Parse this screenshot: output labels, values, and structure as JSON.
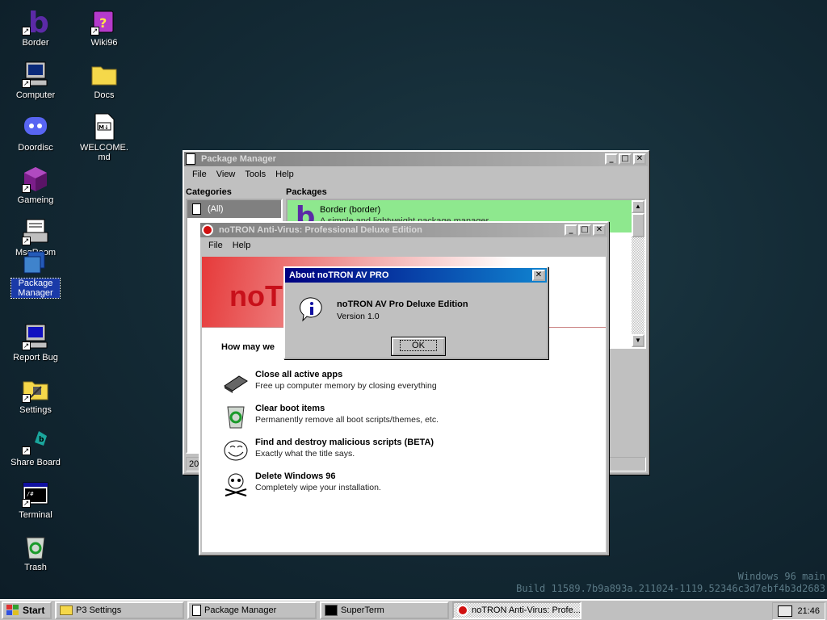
{
  "desktop": {
    "icons": [
      {
        "label": "Border",
        "icon": "border-b-icon"
      },
      {
        "label": "Wiki96",
        "icon": "wiki-book-icon"
      },
      {
        "label": "Computer",
        "icon": "computer-icon"
      },
      {
        "label": "Docs",
        "icon": "folder-icon"
      },
      {
        "label": "Doordisc",
        "icon": "discord-icon"
      },
      {
        "label": "WELCOME.md",
        "icon": "markdown-file-icon"
      },
      {
        "label": "Gameing",
        "icon": "cube-icon"
      },
      {
        "label": "MsgRoom",
        "icon": "msgroom-icon"
      },
      {
        "label": "Package Manager",
        "icon": "package-manager-icon"
      },
      {
        "label": "Report Bug",
        "icon": "report-bug-icon"
      },
      {
        "label": "Settings",
        "icon": "settings-icon"
      },
      {
        "label": "Share Board",
        "icon": "share-board-icon"
      },
      {
        "label": "Terminal",
        "icon": "terminal-icon"
      },
      {
        "label": "Trash",
        "icon": "trash-icon"
      }
    ],
    "watermark": {
      "line1": "Windows 96 main",
      "line2": "Build 11589.7b9a893a.211024-1119.52346c3d7ebf4b3d2683"
    }
  },
  "package_manager": {
    "title": "Package Manager",
    "menu": [
      "File",
      "View",
      "Tools",
      "Help"
    ],
    "categories_label": "Categories",
    "packages_label": "Packages",
    "category_selected": "(All)",
    "package_name": "Border (border)",
    "package_desc": "A simple and lightweight package manager",
    "status": "20"
  },
  "notron": {
    "title": "noTRON Anti-Virus: Professional Deluxe Edition",
    "menu": [
      "File",
      "Help"
    ],
    "banner": "noT",
    "prompt": "How may we",
    "actions": [
      {
        "title": "Close all active apps",
        "desc": "Free up computer memory by closing everything",
        "icon": "memory-chip-icon"
      },
      {
        "title": "Clear boot items",
        "desc": "Permanently remove all boot scripts/themes, etc.",
        "icon": "recycle-bin-icon"
      },
      {
        "title": "Find and destroy malicious scripts (BETA)",
        "desc": "Exactly what the title says.",
        "icon": "trollface-icon"
      },
      {
        "title": "Delete Windows 96",
        "desc": "Completely wipe your installation.",
        "icon": "skull-crossbones-icon"
      }
    ]
  },
  "about_dialog": {
    "title": "About noTRON AV PRO",
    "product": "noTRON AV Pro Deluxe Edition",
    "version": "Version 1.0",
    "ok": "OK"
  },
  "taskbar": {
    "start": "Start",
    "tasks": [
      {
        "label": "P3 Settings",
        "icon": "settings-icon"
      },
      {
        "label": "Package Manager",
        "icon": "package-icon"
      },
      {
        "label": "SuperTerm",
        "icon": "terminal-icon"
      },
      {
        "label": "noTRON Anti-Virus: Profe...",
        "icon": "notron-icon"
      }
    ],
    "clock": "21:46"
  }
}
